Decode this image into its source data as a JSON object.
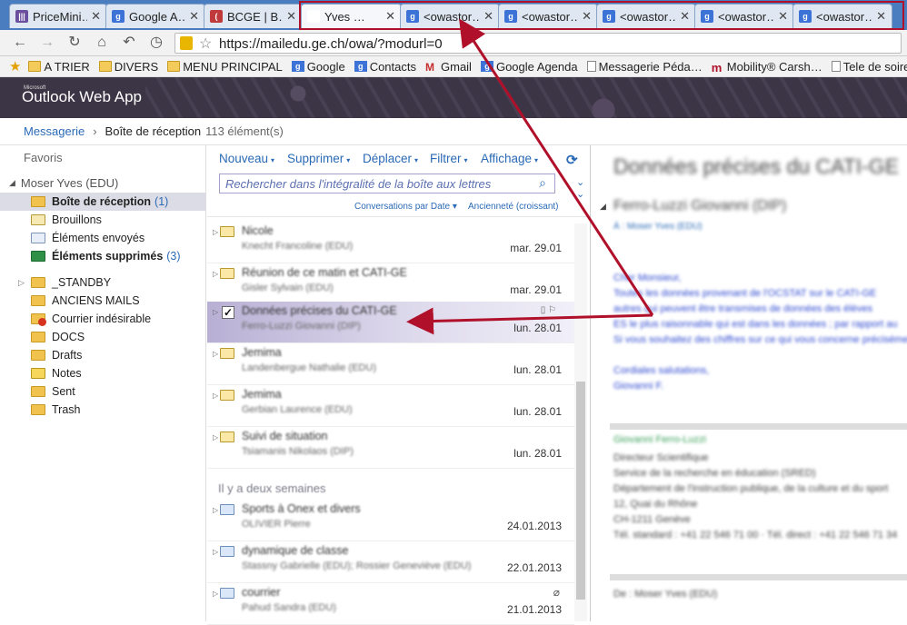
{
  "browser": {
    "tabs": [
      {
        "label": "PriceMini…",
        "icon": "pricemini-icon",
        "color": "#6b4f9e",
        "active": false
      },
      {
        "label": "Google A…",
        "icon": "google-calendar-icon",
        "color": "#3d72d6",
        "active": false
      },
      {
        "label": "BCGE | B…",
        "icon": "bcge-icon",
        "color": "#c0393b",
        "active": false
      },
      {
        "label": "Yves …",
        "icon": "owa-tab-icon",
        "color": "#ffffff",
        "active": true
      },
      {
        "label": "<owastor…",
        "icon": "google-icon",
        "color": "#3d72d6",
        "active": false
      },
      {
        "label": "<owastor…",
        "icon": "google-icon",
        "color": "#3d72d6",
        "active": false
      },
      {
        "label": "<owastor…",
        "icon": "google-icon",
        "color": "#3d72d6",
        "active": false
      },
      {
        "label": "<owastor…",
        "icon": "google-icon",
        "color": "#3d72d6",
        "active": false
      },
      {
        "label": "<owastor…",
        "icon": "google-icon",
        "color": "#3d72d6",
        "active": false
      }
    ],
    "url": "https://mailedu.ge.ch/owa/?modurl=0",
    "bookmarks": [
      {
        "label": "A TRIER",
        "icon": "folder-icon"
      },
      {
        "label": "DIVERS",
        "icon": "folder-icon"
      },
      {
        "label": "MENU PRINCIPAL",
        "icon": "folder-icon"
      },
      {
        "label": "Google",
        "icon": "google-icon"
      },
      {
        "label": "Contacts",
        "icon": "google-icon"
      },
      {
        "label": "Gmail",
        "icon": "gmail-icon"
      },
      {
        "label": "Google Agenda",
        "icon": "google-calendar-icon"
      },
      {
        "label": "Messagerie Péda…",
        "icon": "page-icon"
      },
      {
        "label": "Mobility® Carsh…",
        "icon": "mobility-icon"
      },
      {
        "label": "Tele de soiree: Pr…",
        "icon": "page-icon"
      }
    ]
  },
  "owa": {
    "logo_small": "Microsoft",
    "logo": "Outlook Web App",
    "breadcrumb": {
      "root": "Messagerie",
      "current": "Boîte de réception",
      "count": "113 élément(s)"
    }
  },
  "nav": {
    "favorites": "Favoris",
    "account": "Moser Yves (EDU)",
    "folders": [
      {
        "label": "Boîte de réception",
        "count": "(1)",
        "bold": true,
        "icon": "inbox-icon",
        "class": "fi-folder"
      },
      {
        "label": "Brouillons",
        "count": "",
        "bold": false,
        "icon": "drafts-icon",
        "class": "fi-draft"
      },
      {
        "label": "Éléments envoyés",
        "count": "",
        "bold": false,
        "icon": "sent-items-icon",
        "class": "fi-sent"
      },
      {
        "label": "Éléments supprimés",
        "count": "(3)",
        "bold": true,
        "icon": "trash-icon",
        "class": "fi-trash"
      }
    ],
    "other_folders": [
      {
        "label": "_STANDBY",
        "expand": true,
        "icon": "folder-icon",
        "class": "fi-folder"
      },
      {
        "label": "ANCIENS MAILS",
        "expand": false,
        "icon": "folder-icon",
        "class": "fi-folder"
      },
      {
        "label": "Courrier indésirable",
        "expand": false,
        "icon": "junk-folder-icon",
        "class": "fi-junk"
      },
      {
        "label": "DOCS",
        "expand": false,
        "icon": "folder-icon",
        "class": "fi-folder"
      },
      {
        "label": "Drafts",
        "expand": false,
        "icon": "folder-icon",
        "class": "fi-folder"
      },
      {
        "label": "Notes",
        "expand": false,
        "icon": "notes-icon",
        "class": "fi-notes"
      },
      {
        "label": "Sent",
        "expand": false,
        "icon": "folder-icon",
        "class": "fi-folder"
      },
      {
        "label": "Trash",
        "expand": false,
        "icon": "folder-icon",
        "class": "fi-folder"
      }
    ]
  },
  "list": {
    "commands": [
      "Nouveau",
      "Supprimer",
      "Déplacer",
      "Filtrer",
      "Affichage"
    ],
    "search_placeholder": "Rechercher dans l'intégralité de la boîte aux lettres",
    "sort_by": "Conversations par Date",
    "sort_order": "Ancienneté (croissant)",
    "group_label": "Il y a deux semaines",
    "messages": [
      {
        "subject": "Nicole",
        "from": "Knecht Francoline (EDU)",
        "date": "mar. 29.01",
        "selected": false
      },
      {
        "subject": "Réunion de ce matin et CATI-GE",
        "from": "Gisler Sylvain (EDU)",
        "date": "mar. 29.01",
        "selected": false
      },
      {
        "subject": "Données précises du CATI-GE",
        "from": "Ferro-Luzzi Giovanni (DIP)",
        "date": "lun. 28.01",
        "selected": true
      },
      {
        "subject": "Jemima",
        "from": "Landenbergue Nathalie (EDU)",
        "date": "lun. 28.01",
        "selected": false
      },
      {
        "subject": "Jemima",
        "from": "Gerbian Laurence (EDU)",
        "date": "lun. 28.01",
        "selected": false
      },
      {
        "subject": "Suivi de situation",
        "from": "Tsiamanis Nikolaos (DIP)",
        "date": "lun. 28.01",
        "selected": false
      },
      {
        "subject": "Sports à Onex et divers",
        "from": "OLIVIER Pierre",
        "date": "24.01.2013",
        "selected": false
      },
      {
        "subject": "dynamique de classe",
        "from": "Stassny Gabrielle (EDU); Rossier Geneviève (EDU)",
        "date": "22.01.2013",
        "selected": false
      },
      {
        "subject": "courrier",
        "from": "Pahud Sandra (EDU)",
        "date": "21.01.2013",
        "selected": false
      }
    ]
  },
  "reader": {
    "title": "Données précises du CATI-GE",
    "from": "Ferro-Luzzi Giovanni (DIP)",
    "to": "À : Moser Yves (EDU)",
    "body_lines": [
      "Cher Monsieur,",
      "Toutes les données provenant de l'OCSTAT sur le CATI-GE",
      "autres qui peuvent être transmises de données des élèves",
      "ES le plus raisonnable qui est dans les données ; par rapport au",
      "Si vous souhaitez des chiffres sur ce qui vous concerne précisément",
      "",
      "Cordiales salutations,",
      "Giovanni F."
    ],
    "signature_name": "Giovanni Ferro-Luzzi",
    "signature_lines": [
      "Directeur Scientifique",
      "Service de la recherche en éducation (SRED)",
      "Département de l'instruction publique, de la culture et du sport",
      "12, Quai du Rhône",
      "CH-1211 Genève",
      "Tél. standard : +41 22 546 71 00 · Tél. direct : +41 22 546 71 34"
    ],
    "bottom": "De : Moser Yves (EDU)"
  }
}
